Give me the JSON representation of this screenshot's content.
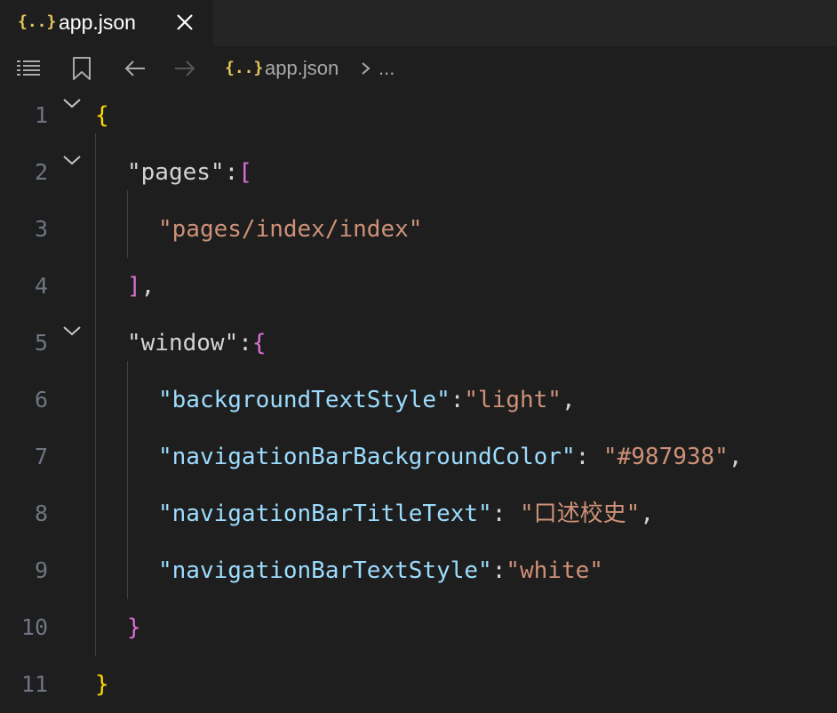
{
  "tab": {
    "icon": "{..}",
    "label": "app.json"
  },
  "breadcrumb": {
    "file_icon": "{..}",
    "file": "app.json",
    "ellipsis": "..."
  },
  "lines": [
    {
      "num": "1",
      "open": "{"
    },
    {
      "num": "2",
      "key": "\"pages\"",
      "colon": ":",
      "open": "["
    },
    {
      "num": "3",
      "value": "\"pages/index/index\""
    },
    {
      "num": "4",
      "close": "]",
      "comma": ","
    },
    {
      "num": "5",
      "key": "\"window\"",
      "colon": ":",
      "open": "{"
    },
    {
      "num": "6",
      "key": "\"backgroundTextStyle\"",
      "colon": ":",
      "value": "\"light\"",
      "comma": ","
    },
    {
      "num": "7",
      "key": "\"navigationBarBackgroundColor\"",
      "colon": ": ",
      "value": "\"#987938\"",
      "comma": ","
    },
    {
      "num": "8",
      "key": "\"navigationBarTitleText\"",
      "colon": ": ",
      "value": "\"口述校史\"",
      "comma": ","
    },
    {
      "num": "9",
      "key": "\"navigationBarTextStyle\"",
      "colon": ":",
      "value": "\"white\""
    },
    {
      "num": "10",
      "close": "}"
    },
    {
      "num": "11",
      "close": "}"
    }
  ],
  "colors": {
    "key": "#9cdcfe",
    "string": "#ce9178",
    "bracket_level1": "#ffd700",
    "bracket_level2": "#da70d6",
    "line_number": "#6e7681",
    "background": "#1e1e1e"
  },
  "icons": [
    "json-file-icon",
    "close-icon",
    "outline-list-icon",
    "bookmark-icon",
    "arrow-left-icon",
    "arrow-right-icon",
    "chevron-right-icon",
    "chevron-down-icon"
  ]
}
